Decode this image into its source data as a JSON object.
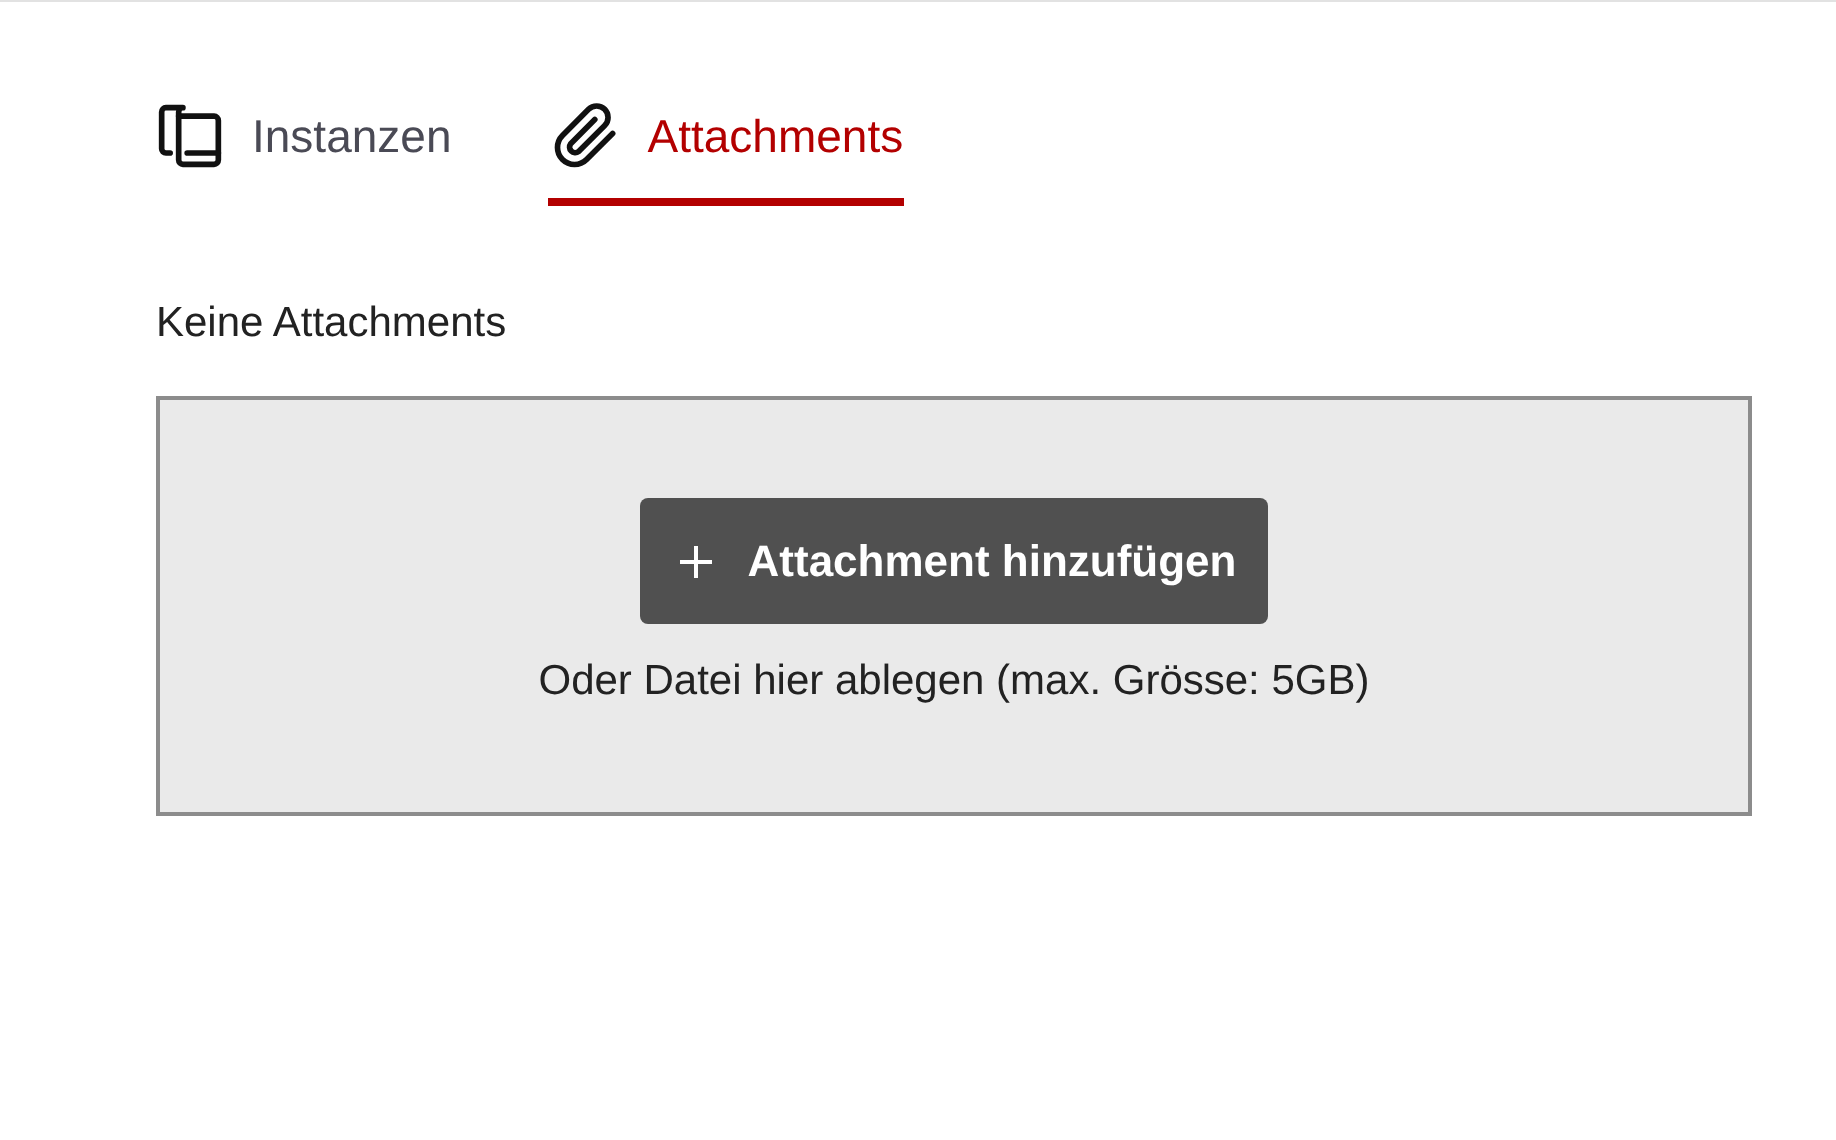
{
  "tabs": [
    {
      "label": "Instanzen",
      "selected": false
    },
    {
      "label": "Attachments",
      "selected": true
    }
  ],
  "status_text": "Keine Attachments",
  "dropzone": {
    "button": "Attachment hinzufügen",
    "hint": "Oder Datei hier ablegen (max. Grösse: 5GB)"
  }
}
